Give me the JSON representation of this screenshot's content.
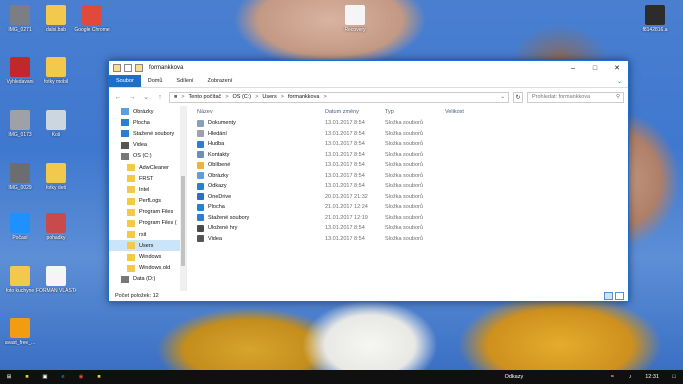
{
  "desktop_icons": [
    {
      "label": "IMG_0271",
      "color": "#7d7e84"
    },
    {
      "label": "dalsi.bab",
      "color": "#f2c94c"
    },
    {
      "label": "Google Chrome",
      "color": "#e0493c"
    },
    {
      "label": "Vyhledavani",
      "color": "#c1272d"
    },
    {
      "label": "fotky mobil",
      "color": "#f2c94c"
    },
    {
      "label": "IMG_0173",
      "color": "#a0a0a8"
    },
    {
      "label": "Koš",
      "color": "#ccd6e0"
    },
    {
      "label": "IMG_0029",
      "color": "#6b6d70"
    },
    {
      "label": "fotky deti",
      "color": "#f2c94c"
    },
    {
      "label": "Počasí",
      "color": "#1e90ff"
    },
    {
      "label": "pohadky",
      "color": "#c94a4a"
    },
    {
      "label": "foto kuchyne",
      "color": "#f2c94c"
    },
    {
      "label": "FORMAN VLASTA",
      "color": "#f5f5f5"
    },
    {
      "label": "avast_free_...",
      "color": "#f39c12"
    },
    {
      "label": "Recovery",
      "color": "#f5f5f5"
    },
    {
      "label": "f8142816.a",
      "color": "#2c2c2c"
    }
  ],
  "window": {
    "title": "formankkova",
    "ribbon_tabs": [
      "Soubor",
      "Domů",
      "Sdílení",
      "Zobrazení"
    ],
    "address": [
      "Tento počítač",
      "OS (C:)",
      "Users",
      "formankkova"
    ],
    "search_placeholder": "Prohledat: formankkova",
    "status": "Počet položek: 12"
  },
  "nav_items": [
    {
      "label": "Obrázky",
      "indent": 0,
      "color": "#5aa0e0"
    },
    {
      "label": "Plocha",
      "indent": 0,
      "color": "#2a7fd4"
    },
    {
      "label": "Stažené soubory",
      "indent": 0,
      "color": "#2a7fd4"
    },
    {
      "label": "Videa",
      "indent": 0,
      "color": "#555"
    },
    {
      "label": "OS (C:)",
      "indent": 0,
      "color": "#777"
    },
    {
      "label": "AdwCleaner",
      "indent": 1,
      "color": "#f2c94c"
    },
    {
      "label": "FRST",
      "indent": 1,
      "color": "#f2c94c"
    },
    {
      "label": "Intel",
      "indent": 1,
      "color": "#f2c94c"
    },
    {
      "label": "PerfLogs",
      "indent": 1,
      "color": "#f2c94c"
    },
    {
      "label": "Program Files",
      "indent": 1,
      "color": "#f2c94c"
    },
    {
      "label": "Program Files (",
      "indent": 1,
      "color": "#f2c94c"
    },
    {
      "label": "rsit",
      "indent": 1,
      "color": "#f2c94c"
    },
    {
      "label": "Users",
      "indent": 1,
      "color": "#f2c94c",
      "selected": true
    },
    {
      "label": "Windows",
      "indent": 1,
      "color": "#f2c94c"
    },
    {
      "label": "Windows.old",
      "indent": 1,
      "color": "#f2c94c"
    },
    {
      "label": "Data (D:)",
      "indent": 0,
      "color": "#777"
    }
  ],
  "columns": [
    "Název",
    "Datum změny",
    "Typ",
    "Velikost"
  ],
  "files": [
    {
      "name": "Dokumenty",
      "date": "13.01.2017 8:54",
      "type": "Složka souborů",
      "color": "#8aa0b8"
    },
    {
      "name": "Hledání",
      "date": "13.01.2017 8:54",
      "type": "Složka souborů",
      "color": "#9aa3ad"
    },
    {
      "name": "Hudba",
      "date": "13.01.2017 8:54",
      "type": "Složka souborů",
      "color": "#2a7fd4"
    },
    {
      "name": "Kontakty",
      "date": "13.01.2017 8:54",
      "type": "Složka souborů",
      "color": "#6a8fb8"
    },
    {
      "name": "Oblíbené",
      "date": "13.01.2017 8:54",
      "type": "Složka souborů",
      "color": "#f2b134"
    },
    {
      "name": "Obrázky",
      "date": "13.01.2017 8:54",
      "type": "Složka souborů",
      "color": "#5aa0e0"
    },
    {
      "name": "Odkazy",
      "date": "13.01.2017 8:54",
      "type": "Složka souborů",
      "color": "#2a7fd4"
    },
    {
      "name": "OneDrive",
      "date": "20.01.2017 21:32",
      "type": "Složka souborů",
      "color": "#2a6fc4"
    },
    {
      "name": "Plocha",
      "date": "21.01.2017 12:24",
      "type": "Složka souborů",
      "color": "#2a7fd4"
    },
    {
      "name": "Stažené soubory",
      "date": "21.01.2017 12:19",
      "type": "Složka souborů",
      "color": "#2a7fd4"
    },
    {
      "name": "Uložené hry",
      "date": "13.01.2017 8:54",
      "type": "Složka souborů",
      "color": "#4a4a4a"
    },
    {
      "name": "Videa",
      "date": "13.01.2017 8:54",
      "type": "Složka souborů",
      "color": "#555"
    }
  ],
  "taskbar": {
    "toolbar_label": "Odkazy",
    "time": "12:31"
  }
}
